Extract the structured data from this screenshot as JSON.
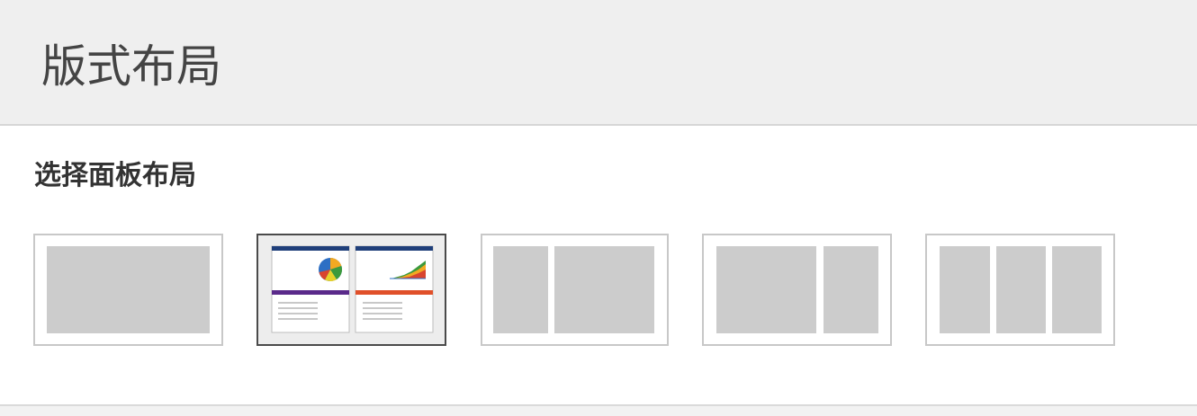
{
  "header": {
    "title": "版式布局"
  },
  "section": {
    "label": "选择面板布局"
  },
  "layout_options": [
    {
      "name": "single-pane",
      "selected": false
    },
    {
      "name": "two-panel-report",
      "selected": true
    },
    {
      "name": "narrow-wide",
      "selected": false
    },
    {
      "name": "wide-narrow",
      "selected": false
    },
    {
      "name": "three-columns",
      "selected": false
    }
  ],
  "colors": {
    "header_bg": "#efefef",
    "pane_gray": "#cccccc",
    "selected_border": "#4a4a4a",
    "option_border": "#c8c8c8",
    "navy_bar": "#1f3f7a",
    "purple_bar": "#5a2a8a",
    "orange_bar": "#e0502a"
  }
}
